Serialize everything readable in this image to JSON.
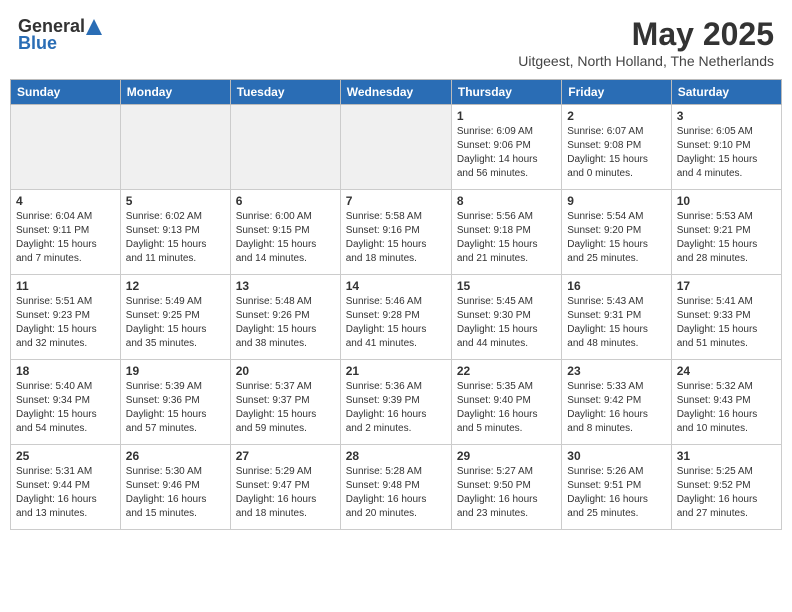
{
  "logo": {
    "general": "General",
    "blue": "Blue"
  },
  "title": {
    "month": "May 2025",
    "location": "Uitgeest, North Holland, The Netherlands"
  },
  "weekdays": [
    "Sunday",
    "Monday",
    "Tuesday",
    "Wednesday",
    "Thursday",
    "Friday",
    "Saturday"
  ],
  "weeks": [
    [
      {
        "day": "",
        "info": ""
      },
      {
        "day": "",
        "info": ""
      },
      {
        "day": "",
        "info": ""
      },
      {
        "day": "",
        "info": ""
      },
      {
        "day": "1",
        "info": "Sunrise: 6:09 AM\nSunset: 9:06 PM\nDaylight: 14 hours\nand 56 minutes."
      },
      {
        "day": "2",
        "info": "Sunrise: 6:07 AM\nSunset: 9:08 PM\nDaylight: 15 hours\nand 0 minutes."
      },
      {
        "day": "3",
        "info": "Sunrise: 6:05 AM\nSunset: 9:10 PM\nDaylight: 15 hours\nand 4 minutes."
      }
    ],
    [
      {
        "day": "4",
        "info": "Sunrise: 6:04 AM\nSunset: 9:11 PM\nDaylight: 15 hours\nand 7 minutes."
      },
      {
        "day": "5",
        "info": "Sunrise: 6:02 AM\nSunset: 9:13 PM\nDaylight: 15 hours\nand 11 minutes."
      },
      {
        "day": "6",
        "info": "Sunrise: 6:00 AM\nSunset: 9:15 PM\nDaylight: 15 hours\nand 14 minutes."
      },
      {
        "day": "7",
        "info": "Sunrise: 5:58 AM\nSunset: 9:16 PM\nDaylight: 15 hours\nand 18 minutes."
      },
      {
        "day": "8",
        "info": "Sunrise: 5:56 AM\nSunset: 9:18 PM\nDaylight: 15 hours\nand 21 minutes."
      },
      {
        "day": "9",
        "info": "Sunrise: 5:54 AM\nSunset: 9:20 PM\nDaylight: 15 hours\nand 25 minutes."
      },
      {
        "day": "10",
        "info": "Sunrise: 5:53 AM\nSunset: 9:21 PM\nDaylight: 15 hours\nand 28 minutes."
      }
    ],
    [
      {
        "day": "11",
        "info": "Sunrise: 5:51 AM\nSunset: 9:23 PM\nDaylight: 15 hours\nand 32 minutes."
      },
      {
        "day": "12",
        "info": "Sunrise: 5:49 AM\nSunset: 9:25 PM\nDaylight: 15 hours\nand 35 minutes."
      },
      {
        "day": "13",
        "info": "Sunrise: 5:48 AM\nSunset: 9:26 PM\nDaylight: 15 hours\nand 38 minutes."
      },
      {
        "day": "14",
        "info": "Sunrise: 5:46 AM\nSunset: 9:28 PM\nDaylight: 15 hours\nand 41 minutes."
      },
      {
        "day": "15",
        "info": "Sunrise: 5:45 AM\nSunset: 9:30 PM\nDaylight: 15 hours\nand 44 minutes."
      },
      {
        "day": "16",
        "info": "Sunrise: 5:43 AM\nSunset: 9:31 PM\nDaylight: 15 hours\nand 48 minutes."
      },
      {
        "day": "17",
        "info": "Sunrise: 5:41 AM\nSunset: 9:33 PM\nDaylight: 15 hours\nand 51 minutes."
      }
    ],
    [
      {
        "day": "18",
        "info": "Sunrise: 5:40 AM\nSunset: 9:34 PM\nDaylight: 15 hours\nand 54 minutes."
      },
      {
        "day": "19",
        "info": "Sunrise: 5:39 AM\nSunset: 9:36 PM\nDaylight: 15 hours\nand 57 minutes."
      },
      {
        "day": "20",
        "info": "Sunrise: 5:37 AM\nSunset: 9:37 PM\nDaylight: 15 hours\nand 59 minutes."
      },
      {
        "day": "21",
        "info": "Sunrise: 5:36 AM\nSunset: 9:39 PM\nDaylight: 16 hours\nand 2 minutes."
      },
      {
        "day": "22",
        "info": "Sunrise: 5:35 AM\nSunset: 9:40 PM\nDaylight: 16 hours\nand 5 minutes."
      },
      {
        "day": "23",
        "info": "Sunrise: 5:33 AM\nSunset: 9:42 PM\nDaylight: 16 hours\nand 8 minutes."
      },
      {
        "day": "24",
        "info": "Sunrise: 5:32 AM\nSunset: 9:43 PM\nDaylight: 16 hours\nand 10 minutes."
      }
    ],
    [
      {
        "day": "25",
        "info": "Sunrise: 5:31 AM\nSunset: 9:44 PM\nDaylight: 16 hours\nand 13 minutes."
      },
      {
        "day": "26",
        "info": "Sunrise: 5:30 AM\nSunset: 9:46 PM\nDaylight: 16 hours\nand 15 minutes."
      },
      {
        "day": "27",
        "info": "Sunrise: 5:29 AM\nSunset: 9:47 PM\nDaylight: 16 hours\nand 18 minutes."
      },
      {
        "day": "28",
        "info": "Sunrise: 5:28 AM\nSunset: 9:48 PM\nDaylight: 16 hours\nand 20 minutes."
      },
      {
        "day": "29",
        "info": "Sunrise: 5:27 AM\nSunset: 9:50 PM\nDaylight: 16 hours\nand 23 minutes."
      },
      {
        "day": "30",
        "info": "Sunrise: 5:26 AM\nSunset: 9:51 PM\nDaylight: 16 hours\nand 25 minutes."
      },
      {
        "day": "31",
        "info": "Sunrise: 5:25 AM\nSunset: 9:52 PM\nDaylight: 16 hours\nand 27 minutes."
      }
    ]
  ]
}
